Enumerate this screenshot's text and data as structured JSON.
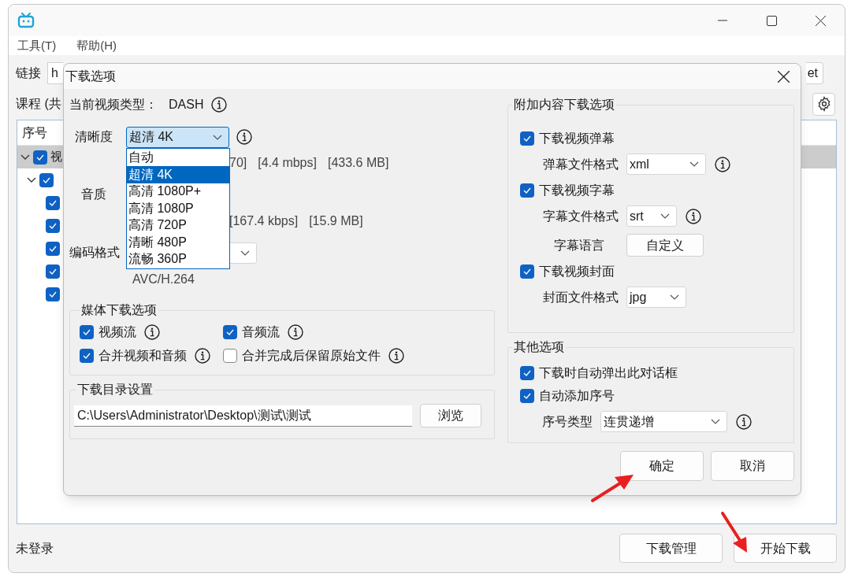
{
  "window": {
    "menu": [
      "工具(T)",
      "帮助(H)"
    ]
  },
  "link": {
    "label": "链接",
    "value": "h",
    "button": "et"
  },
  "course": {
    "label": "课程 (共"
  },
  "table": {
    "header": "序号",
    "rows": [
      {
        "text": "视",
        "checked": true,
        "expanded": true,
        "selected": true,
        "children": [
          {
            "checked": true,
            "expanded": true,
            "selected": false,
            "children": [
              {
                "checked": true,
                "selected": false
              },
              {
                "checked": true,
                "selected": false
              },
              {
                "checked": true,
                "selected": false
              },
              {
                "checked": true,
                "selected": false
              },
              {
                "checked": true,
                "selected": false
              }
            ]
          }
        ]
      }
    ]
  },
  "status": "未登录",
  "buttons": [
    "下载管理",
    "开始下载"
  ],
  "dialog": {
    "title": "下载选项",
    "video_type": {
      "label": "当前视频类型：",
      "value": "DASH"
    },
    "quality": {
      "label": "清晰度",
      "value": "超清 4K",
      "expanded": true,
      "options": [
        {
          "label": "自动",
          "selected": false
        },
        {
          "label": "超清 4K",
          "selected": true
        },
        {
          "label": "高清 1080P+",
          "selected": false
        },
        {
          "label": "高清 1080P",
          "selected": false
        },
        {
          "label": "高清 720P",
          "selected": false
        },
        {
          "label": "清晰 480P",
          "selected": false
        },
        {
          "label": "流畅 360P",
          "selected": false
        }
      ],
      "info": [
        "70]",
        "[4.4 mbps]",
        "[433.6 MB]"
      ]
    },
    "audio": {
      "label": "音质",
      "info": [
        "[167.4 kbps]",
        "[15.9 MB]"
      ]
    },
    "codec": {
      "label": "编码格式",
      "note": "AVC/H.264"
    },
    "media": {
      "title": "媒体下载选项",
      "options": [
        {
          "label": "视频流",
          "checked": true
        },
        {
          "label": "音频流",
          "checked": true
        },
        {
          "label": "合并视频和音频",
          "checked": true
        },
        {
          "label": "合并完成后保留原始文件",
          "checked": false
        }
      ]
    },
    "directory": {
      "title": "下载目录设置",
      "value": "C:\\Users\\Administrator\\Desktop\\测试\\测试",
      "button": "浏览"
    },
    "extra": {
      "title": "附加内容下载选项",
      "items": [
        {
          "kind": "checkbox",
          "label": "下载视频弹幕",
          "checked": true
        },
        {
          "kind": "select",
          "label": "弹幕文件格式",
          "value": "xml",
          "info": true
        },
        {
          "kind": "checkbox",
          "label": "下载视频字幕",
          "checked": true
        },
        {
          "kind": "select",
          "label": "字幕文件格式",
          "value": "srt",
          "info": true
        },
        {
          "kind": "button",
          "label": "字幕语言",
          "value": "自定义"
        },
        {
          "kind": "checkbox",
          "label": "下载视频封面",
          "checked": true
        },
        {
          "kind": "select",
          "label": "封面文件格式",
          "value": "jpg",
          "info": false
        }
      ]
    },
    "other": {
      "title": "其他选项",
      "items": [
        {
          "kind": "checkbox",
          "label": "下载时自动弹出此对话框",
          "checked": true
        },
        {
          "kind": "checkbox",
          "label": "自动添加序号",
          "checked": true
        },
        {
          "kind": "select",
          "label": "序号类型",
          "value": "连贯递增",
          "info": true
        }
      ]
    },
    "buttons": [
      "确定",
      "取消"
    ]
  }
}
